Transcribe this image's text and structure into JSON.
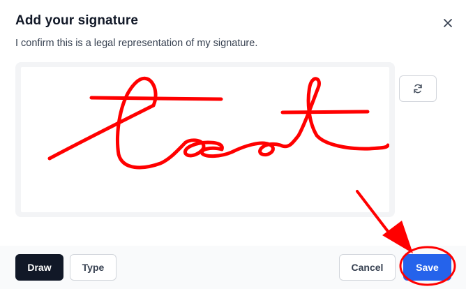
{
  "dialog": {
    "title": "Add your signature",
    "subtitle": "I confirm this is a legal representation of my signature.",
    "close_icon": "close-icon"
  },
  "signature_pad": {
    "stroke_color": "#ff0000",
    "background": "#ffffff",
    "clear_icon": "refresh-icon"
  },
  "footer": {
    "draw_label": "Draw",
    "type_label": "Type",
    "cancel_label": "Cancel",
    "save_label": "Save",
    "active_mode": "Draw"
  },
  "colors": {
    "primary": "#2563eb",
    "dark": "#111827",
    "annotation": "#ff0000"
  }
}
